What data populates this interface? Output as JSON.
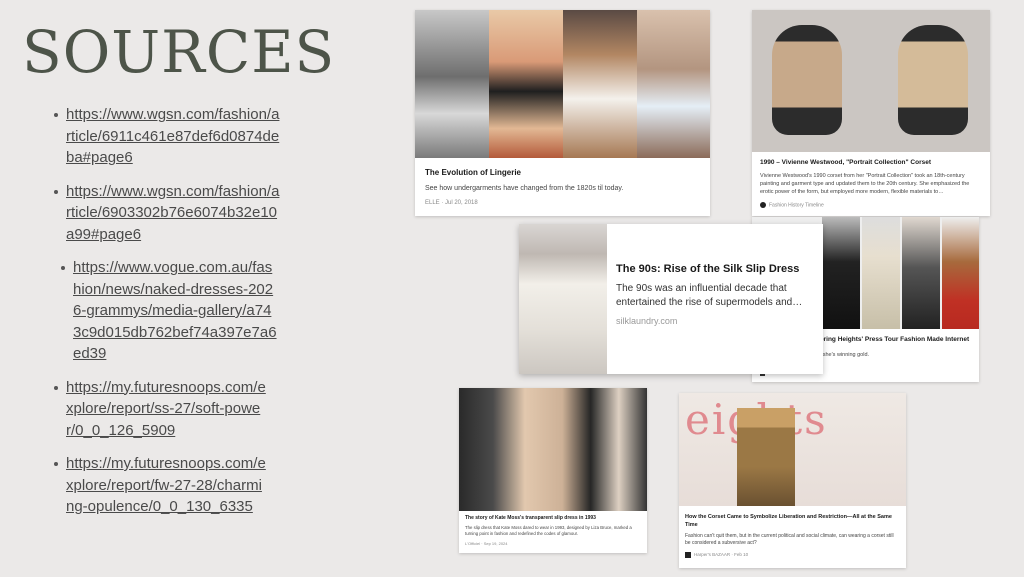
{
  "slide": {
    "title": "SOURCES",
    "links": [
      "https://www.wgsn.com/fashion/article/6911c461e87def6d0874deba#page6",
      "https://www.wgsn.com/fashion/article/6903302b76e6074b32e10a99#page6",
      "https://www.vogue.com.au/fashion/news/naked-dresses-2026-grammys/media-gallery/a743c9d015db762bef74a397e7a6ed39",
      "https://my.futuresnoops.com/explore/report/ss-27/soft-power/0_0_126_5909",
      "https://my.futuresnoops.com/explore/report/fw-27-28/charming-opulence/0_0_130_6335"
    ]
  },
  "cards": {
    "lingerie": {
      "title": "The Evolution of Lingerie",
      "description": "See how undergarments have changed from the 1820s til today.",
      "source": "ELLE · Jul 20, 2018"
    },
    "westwood": {
      "title": "1990 – Vivienne Westwood, \"Portrait Collection\" Corset",
      "description": "Vivienne Westwood's 1990 corset from her \"Portrait Collection\" took an 18th-century painting and garment type and updated them to the 20th century. She emphasized the erotic power of the form, but employed more modern, flexible materials to…",
      "source": "Fashion History Timeline"
    },
    "slip": {
      "title": "The 90s: Rise of the Silk Slip Dress",
      "description": "The 90s was an influential decade that entertained the rise of supermodels and…",
      "source": "silklaundry.com"
    },
    "wuthering": {
      "title_partial": "ering Heights' Press Tour Fashion Made Internet",
      "desc_partial": "l she's winning gold."
    },
    "katemoss": {
      "title": "The story of Kate Moss's transparent slip dress in 1993",
      "description": "The slip dress that Kate Moss dared to wear in 1993, designed by Liza Bruce, marked a turning point in fashion and redefined the codes of glamour.",
      "source": "L'Officiel · Sep 19, 2024"
    },
    "corset": {
      "title": "How the Corset Came to Symbolize Liberation and Restriction—All at the Same Time",
      "description": "Fashion can't quit them, but in the current political and social climate, can wearing a corset still be considered a subversive act?",
      "source": "Harper's BAZAAR · Feb 10",
      "sign_text": "eights"
    }
  },
  "colors": {
    "background": "#ebe9e8",
    "title": "#4d5449",
    "link": "#4a4a4a"
  }
}
